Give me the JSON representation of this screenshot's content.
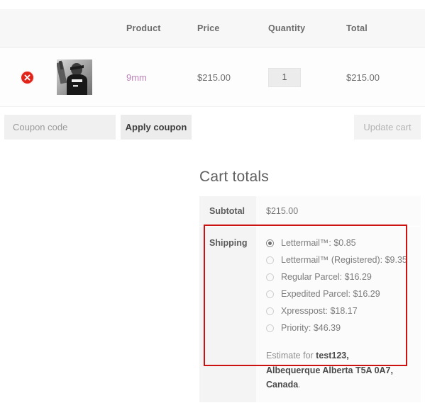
{
  "cart_table": {
    "columns": [
      "",
      "",
      "Product",
      "Price",
      "Quantity",
      "Total"
    ],
    "headers": {
      "product": "Product",
      "price": "Price",
      "quantity": "Quantity",
      "total": "Total"
    },
    "rows": [
      {
        "remove_icon": "remove-circle-x-icon",
        "thumbnail_icon": "product-thumbnail-person-in-black-tshirt",
        "name": "9mm",
        "price": "$215.00",
        "quantity": "1",
        "total": "$215.00"
      }
    ]
  },
  "coupon": {
    "placeholder": "Coupon code",
    "value": "",
    "apply_label": "Apply coupon",
    "update_label": "Update cart"
  },
  "totals": {
    "title": "Cart totals",
    "subtotal_label": "Subtotal",
    "subtotal_value": "$215.00",
    "shipping_label": "Shipping",
    "shipping_options": [
      {
        "label": "Lettermail™: $0.85",
        "selected": true
      },
      {
        "label": "Lettermail™ (Registered): $9.35",
        "selected": false
      },
      {
        "label": "Regular Parcel: $16.29",
        "selected": false
      },
      {
        "label": "Expedited Parcel: $16.29",
        "selected": false
      },
      {
        "label": "Xpresspost: $18.17",
        "selected": false
      },
      {
        "label": "Priority: $46.39",
        "selected": false
      }
    ],
    "estimate_prefix": "Estimate for ",
    "estimate_address": "test123, Albequerque Alberta T5A 0A7, Canada",
    "estimate_suffix": "."
  },
  "colors": {
    "product_link": "#b983b5",
    "remove_button": "#e2231a",
    "annotation_border": "#cc1111",
    "header_bg": "#f7f7f7",
    "label_cell_bg": "#f4f4f4"
  }
}
